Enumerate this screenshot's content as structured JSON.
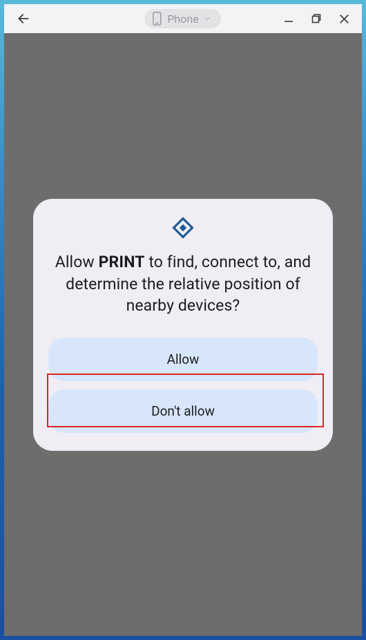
{
  "titlebar": {
    "device_label": "Phone"
  },
  "dialog": {
    "text_prefix": "Allow ",
    "app_name": "PRINT",
    "text_suffix": " to find, connect to, and determine the relative position of nearby devices?",
    "allow_label": "Allow",
    "deny_label": "Don't allow"
  }
}
